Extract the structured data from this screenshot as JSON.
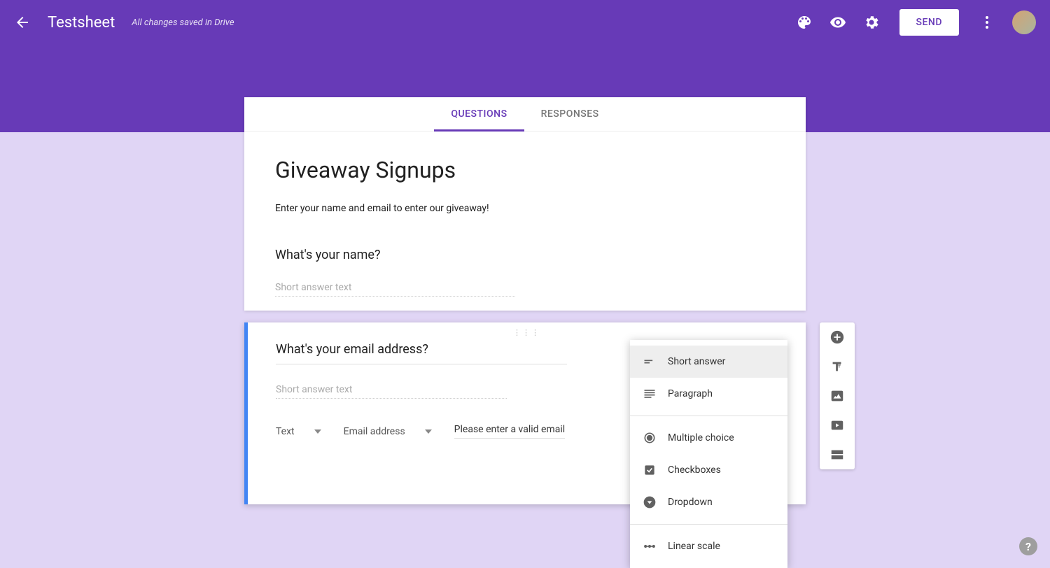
{
  "header": {
    "doc_title": "Testsheet",
    "save_status": "All changes saved in Drive",
    "send_label": "SEND"
  },
  "tabs": {
    "questions": "QUESTIONS",
    "responses": "RESPONSES"
  },
  "form": {
    "title": "Giveaway Signups",
    "description": "Enter your name and email to enter our giveaway!"
  },
  "q1": {
    "title": "What's your name?",
    "placeholder": "Short answer text"
  },
  "q2": {
    "title": "What's your email address?",
    "placeholder": "Short answer text",
    "validation_type": "Text",
    "validation_subtype": "Email address",
    "error_text": "Please enter a valid email"
  },
  "dd": {
    "short_answer": "Short answer",
    "paragraph": "Paragraph",
    "multiple_choice": "Multiple choice",
    "checkboxes": "Checkboxes",
    "dropdown": "Dropdown",
    "linear_scale": "Linear scale"
  },
  "icons": {
    "back": "back-arrow",
    "palette": "palette",
    "preview": "eye",
    "settings": "gear",
    "more": "vertical-dots",
    "add": "plus-circle",
    "text_block": "text-Tt",
    "image": "image",
    "video": "video",
    "section": "section",
    "help": "?"
  }
}
